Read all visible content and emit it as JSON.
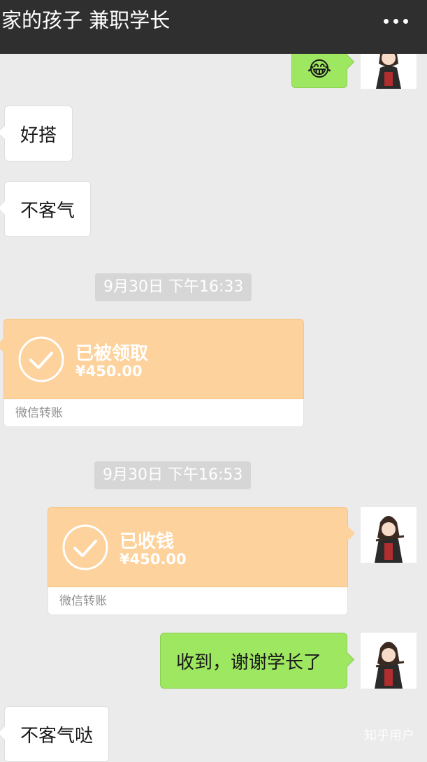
{
  "header": {
    "title": "家的孩子 兼职学长",
    "more_icon": "more-dots-icon"
  },
  "messages": {
    "emoji_msg": {
      "text": "😂",
      "icon": "tears-of-joy-emoji-icon"
    },
    "msg1": "好搭",
    "msg2": "不客气",
    "time1": "9月30日 下午16:33",
    "transfer1": {
      "status": "已被领取",
      "amount": "¥450.00",
      "label": "微信转账"
    },
    "time2": "9月30日 下午16:53",
    "transfer2": {
      "status": "已收钱",
      "amount": "¥450.00",
      "label": "微信转账"
    },
    "msg3": "收到，谢谢学长了",
    "msg4": "不客气哒"
  },
  "watermark": "知乎用户",
  "colors": {
    "header_bg": "#2f2f2f",
    "chat_bg": "#ebebeb",
    "green_bubble": "#9ee761",
    "transfer_orange": "#fdd29c",
    "timestamp_bg": "#d6d6d6"
  }
}
